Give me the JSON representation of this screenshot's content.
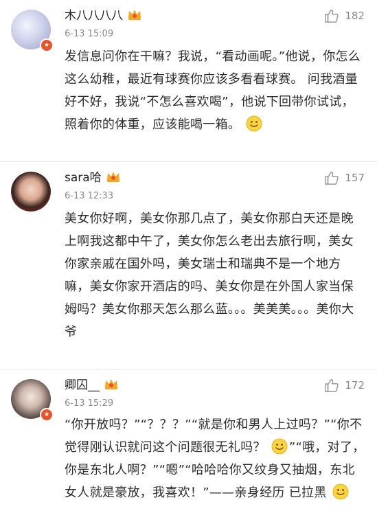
{
  "comments": [
    {
      "username": "木八八八八",
      "time": "6-13 15:09",
      "likes": "182",
      "has_v_badge": true,
      "text_before_emoji": "发信息问你在干嘛？我说，“看动画呢。”他说，你怎么这么幼稚，最近有球赛你应该多看看球赛。 问我酒量好不好，我说“不怎么喜欢喝”，他说下回带你试试，照着你的体重，应该能喝一箱。",
      "text_after_emoji": ""
    },
    {
      "username": "sara哈",
      "time": "6-13 12:33",
      "likes": "157",
      "has_v_badge": false,
      "text_before_emoji": "美女你好啊，美女你那几点了，美女你那白天还是晚上啊我这都中午了，美女你怎么老出去旅行啊，美女你家亲戚在国外吗，美女瑞士和瑞典不是一个地方嘛，美女你家开酒店的吗、美女你是在外国人家当保姆吗？美女你那天怎么那么蓝。。。美美美。。。美你大爷",
      "text_after_emoji": ""
    },
    {
      "username": "卿囚__",
      "time": "6-13 15:29",
      "likes": "172",
      "has_v_badge": true,
      "text_part1": "“你开放吗？”“？？？”“就是你和男人上过吗？”“你不觉得刚认识就问这个问题很无礼吗？",
      "text_part2": "”“哦，对了，你是东北人啊？”“嗯”“哈哈哈你又纹身又抽烟，东北女人就是豪放，我喜欢！”——亲身经历 已拉黑"
    }
  ],
  "icons": {
    "like": "thumbs-up-icon",
    "member": "crown-icon",
    "emoji": "smiley-icon",
    "verified": "v-badge-icon"
  },
  "colors": {
    "badge": "#e8532a",
    "crown": "#f5a623",
    "meta": "#8a8a8a"
  }
}
